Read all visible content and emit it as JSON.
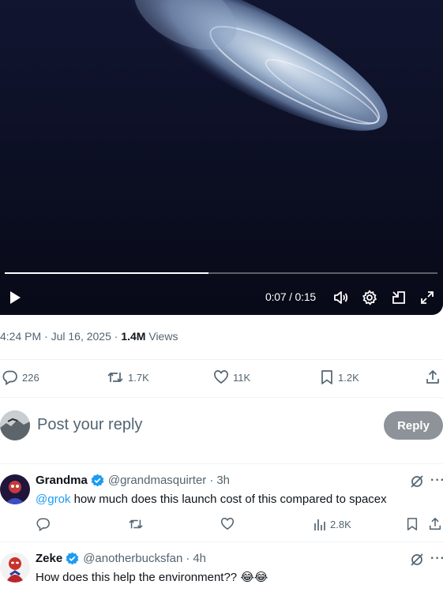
{
  "video": {
    "time_current": "0:07",
    "time_total": "0:15",
    "progress_fraction": 0.47
  },
  "post_meta": {
    "time": "4:24 PM",
    "date": "Jul 16, 2025",
    "views_count": "1.4M",
    "views_label": "Views",
    "separator": "·"
  },
  "actions": {
    "replies": "226",
    "reposts": "1.7K",
    "likes": "11K",
    "bookmarks": "1.2K"
  },
  "composer": {
    "placeholder": "Post your reply",
    "reply_button": "Reply"
  },
  "replies": [
    {
      "name": "Grandma",
      "handle": "@grandmasquirter",
      "time": "3h",
      "mention": "@grok",
      "text": " how much does this launch cost of this compared to spacex",
      "views": "2.8K"
    },
    {
      "name": "Zeke",
      "handle": "@anotherbucksfan",
      "time": "4h",
      "text": "How does this help the environment?? 😂😂"
    }
  ],
  "colors": {
    "accent": "#1d9bf0",
    "muted": "#536471",
    "reply_button": "#8e9399",
    "video_bg": "#0c0f22"
  }
}
